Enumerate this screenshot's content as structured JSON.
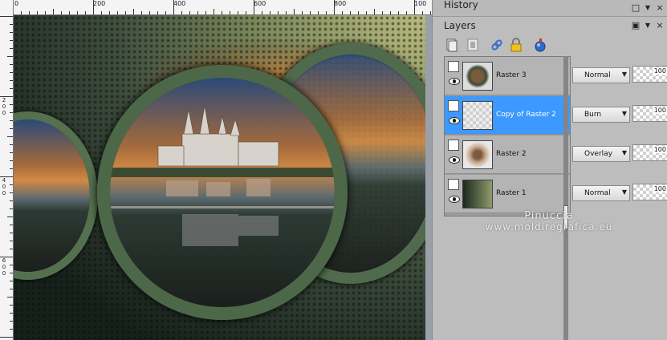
{
  "ruler": {
    "top_labels": [
      "0",
      "200",
      "400",
      "600",
      "800",
      "100"
    ],
    "left_labels": [
      "2",
      "0",
      "0",
      "4",
      "0",
      "0",
      "6",
      "0",
      "0"
    ]
  },
  "history_panel": {
    "title": "History"
  },
  "layers_panel": {
    "title": "Layers",
    "layers": [
      {
        "name": "Raster 3",
        "blend_mode": "Normal",
        "opacity": "100",
        "selected": false
      },
      {
        "name": "Copy of Raster 2",
        "blend_mode": "Burn",
        "opacity": "100",
        "selected": true
      },
      {
        "name": "Raster 2",
        "blend_mode": "Overlay",
        "opacity": "100",
        "selected": false
      },
      {
        "name": "Raster 1",
        "blend_mode": "Normal",
        "opacity": "100",
        "selected": false
      }
    ]
  },
  "watermark": {
    "line1": "Pinuccia",
    "line2": "www.moldiregrafica.eu"
  },
  "icons": {
    "toolbar": [
      "new-layer-icon",
      "mask-icon",
      "link-icon",
      "lock-icon",
      "layer-style-icon"
    ],
    "header": [
      "dock-icon",
      "menu-arrow-icon",
      "close-icon"
    ]
  },
  "colors": {
    "selected_row": "#3d98ff",
    "panel_bg": "#bdbdbd"
  }
}
